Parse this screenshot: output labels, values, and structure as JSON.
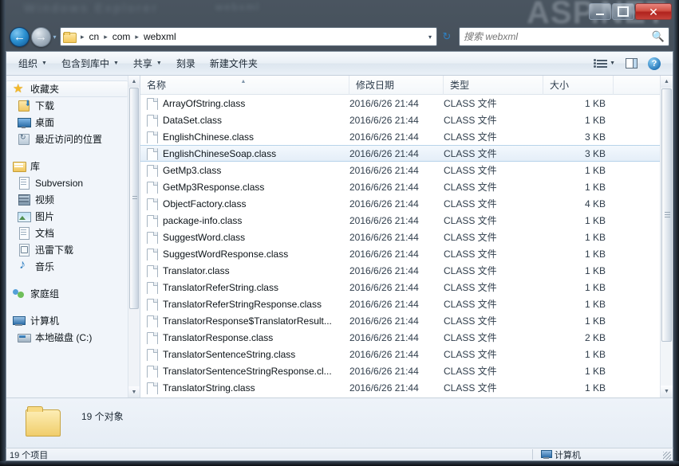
{
  "window": {
    "watermark": "ASP.NET",
    "watermark_left": "Windows Explorer",
    "watermark_mid": "webxml",
    "controls": {
      "minimize": "minimize-button",
      "maximize": "maximize-button",
      "close": "✕"
    }
  },
  "nav": {
    "back_glyph": "←",
    "forward_glyph": "→",
    "recent_glyph": "▾",
    "refresh_glyph": "↻",
    "dropdown_glyph": "▾",
    "breadcrumbs": [
      "cn",
      "com",
      "webxml"
    ],
    "separator": "▸"
  },
  "search": {
    "placeholder": "搜索 webxml",
    "value": "",
    "icon": "search-icon"
  },
  "command_bar": {
    "buttons": [
      {
        "label": "组织",
        "has_caret": true
      },
      {
        "label": "包含到库中",
        "has_caret": true
      },
      {
        "label": "共享",
        "has_caret": true
      },
      {
        "label": "刻录",
        "has_caret": false
      },
      {
        "label": "新建文件夹",
        "has_caret": false
      }
    ],
    "caret": "▼",
    "views_label": "views-icon",
    "preview_label": "preview-pane-icon",
    "help_label": "?"
  },
  "sidebar": {
    "groups": [
      {
        "root": {
          "label": "收藏夹",
          "icon": "star-icon",
          "selected": true
        },
        "items": [
          {
            "label": "下载",
            "icon": "download-icon"
          },
          {
            "label": "桌面",
            "icon": "desktop-icon"
          },
          {
            "label": "最近访问的位置",
            "icon": "recent-places-icon"
          }
        ]
      },
      {
        "root": {
          "label": "库",
          "icon": "library-icon",
          "selected": false
        },
        "items": [
          {
            "label": "Subversion",
            "icon": "document-icon"
          },
          {
            "label": "视频",
            "icon": "video-icon"
          },
          {
            "label": "图片",
            "icon": "picture-icon"
          },
          {
            "label": "文档",
            "icon": "document-icon"
          },
          {
            "label": "迅雷下载",
            "icon": "thunder-download-icon"
          },
          {
            "label": "音乐",
            "icon": "music-icon"
          }
        ]
      },
      {
        "root": {
          "label": "家庭组",
          "icon": "homegroup-icon",
          "selected": false
        },
        "items": []
      },
      {
        "root": {
          "label": "计算机",
          "icon": "computer-icon",
          "selected": false
        },
        "items": [
          {
            "label": "本地磁盘 (C:)",
            "icon": "drive-icon"
          }
        ]
      }
    ]
  },
  "file_list": {
    "columns": [
      {
        "key": "name",
        "label": "名称",
        "sorted": true
      },
      {
        "key": "date",
        "label": "修改日期",
        "sorted": false
      },
      {
        "key": "type",
        "label": "类型",
        "sorted": false
      },
      {
        "key": "size",
        "label": "大小",
        "sorted": false
      }
    ],
    "sort_glyph": "▲",
    "rows": [
      {
        "name": "ArrayOfString.class",
        "date": "2016/6/26 21:44",
        "type": "CLASS 文件",
        "size": "1 KB",
        "selected": false
      },
      {
        "name": "DataSet.class",
        "date": "2016/6/26 21:44",
        "type": "CLASS 文件",
        "size": "1 KB",
        "selected": false
      },
      {
        "name": "EnglishChinese.class",
        "date": "2016/6/26 21:44",
        "type": "CLASS 文件",
        "size": "3 KB",
        "selected": false
      },
      {
        "name": "EnglishChineseSoap.class",
        "date": "2016/6/26 21:44",
        "type": "CLASS 文件",
        "size": "3 KB",
        "selected": true
      },
      {
        "name": "GetMp3.class",
        "date": "2016/6/26 21:44",
        "type": "CLASS 文件",
        "size": "1 KB",
        "selected": false
      },
      {
        "name": "GetMp3Response.class",
        "date": "2016/6/26 21:44",
        "type": "CLASS 文件",
        "size": "1 KB",
        "selected": false
      },
      {
        "name": "ObjectFactory.class",
        "date": "2016/6/26 21:44",
        "type": "CLASS 文件",
        "size": "4 KB",
        "selected": false
      },
      {
        "name": "package-info.class",
        "date": "2016/6/26 21:44",
        "type": "CLASS 文件",
        "size": "1 KB",
        "selected": false
      },
      {
        "name": "SuggestWord.class",
        "date": "2016/6/26 21:44",
        "type": "CLASS 文件",
        "size": "1 KB",
        "selected": false
      },
      {
        "name": "SuggestWordResponse.class",
        "date": "2016/6/26 21:44",
        "type": "CLASS 文件",
        "size": "1 KB",
        "selected": false
      },
      {
        "name": "Translator.class",
        "date": "2016/6/26 21:44",
        "type": "CLASS 文件",
        "size": "1 KB",
        "selected": false
      },
      {
        "name": "TranslatorReferString.class",
        "date": "2016/6/26 21:44",
        "type": "CLASS 文件",
        "size": "1 KB",
        "selected": false
      },
      {
        "name": "TranslatorReferStringResponse.class",
        "date": "2016/6/26 21:44",
        "type": "CLASS 文件",
        "size": "1 KB",
        "selected": false
      },
      {
        "name": "TranslatorResponse$TranslatorResult...",
        "date": "2016/6/26 21:44",
        "type": "CLASS 文件",
        "size": "1 KB",
        "selected": false
      },
      {
        "name": "TranslatorResponse.class",
        "date": "2016/6/26 21:44",
        "type": "CLASS 文件",
        "size": "2 KB",
        "selected": false
      },
      {
        "name": "TranslatorSentenceString.class",
        "date": "2016/6/26 21:44",
        "type": "CLASS 文件",
        "size": "1 KB",
        "selected": false
      },
      {
        "name": "TranslatorSentenceStringResponse.cl...",
        "date": "2016/6/26 21:44",
        "type": "CLASS 文件",
        "size": "1 KB",
        "selected": false
      },
      {
        "name": "TranslatorString.class",
        "date": "2016/6/26 21:44",
        "type": "CLASS 文件",
        "size": "1 KB",
        "selected": false
      }
    ]
  },
  "details_pane": {
    "icon": "folder-icon",
    "text": "19 个对象"
  },
  "status_bar": {
    "left": "19 个项目",
    "right": "计算机",
    "right_icon": "computer-icon"
  },
  "colors": {
    "selection": "#e4eef8",
    "selection_border": "#b8d3ea",
    "close_button": "#c6423a",
    "accent_blue": "#2a8fd0"
  }
}
